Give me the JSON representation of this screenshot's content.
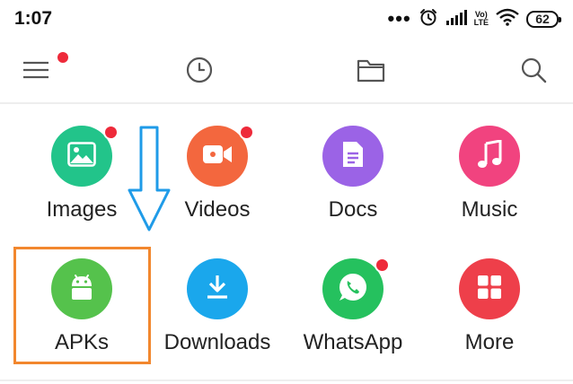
{
  "status_bar": {
    "time": "1:07",
    "dots": "•••",
    "volte_top": "Vo)",
    "volte_bottom": "LTE",
    "battery": "62"
  },
  "toolbar": {
    "icons": [
      "menu-icon",
      "history-icon",
      "folder-icon",
      "search-icon"
    ],
    "menu_has_notification": true
  },
  "categories": [
    {
      "label": "Images",
      "icon": "image-icon",
      "color": "#22c48a",
      "badge": true
    },
    {
      "label": "Videos",
      "icon": "video-icon",
      "color": "#f3673e",
      "badge": true
    },
    {
      "label": "Docs",
      "icon": "document-icon",
      "color": "#9b63e6",
      "badge": false
    },
    {
      "label": "Music",
      "icon": "music-icon",
      "color": "#f1437f",
      "badge": false
    },
    {
      "label": "APKs",
      "icon": "android-icon",
      "color": "#55c24c",
      "badge": false
    },
    {
      "label": "Downloads",
      "icon": "download-icon",
      "color": "#1aa7ec",
      "badge": false
    },
    {
      "label": "WhatsApp",
      "icon": "whatsapp-icon",
      "color": "#25c15e",
      "badge": true
    },
    {
      "label": "More",
      "icon": "grid-icon",
      "color": "#ee3f4a",
      "badge": false
    }
  ],
  "annotations": {
    "arrow_color": "#1f9be8",
    "highlight_color": "#f2872e",
    "highlighted_item": "APKs"
  }
}
